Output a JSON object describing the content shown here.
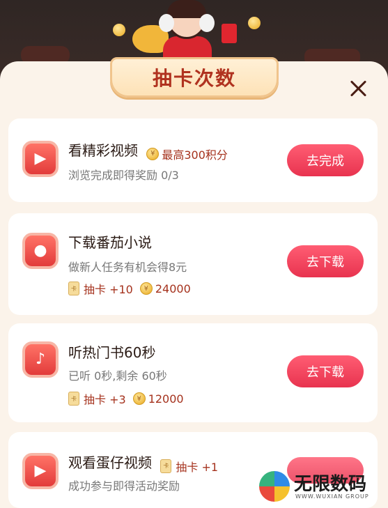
{
  "modal": {
    "title": "抽卡次数"
  },
  "tasks": [
    {
      "title": "看精彩视频",
      "title_reward": "最高300积分",
      "desc": "浏览完成即得奖励 0/3",
      "button": "去完成",
      "icon": "video-ad-icon"
    },
    {
      "title": "下载番茄小说",
      "desc": "做新人任务有机会得8元",
      "card_reward": "抽卡 +10",
      "coin_reward": "24000",
      "button": "去下载",
      "icon": "tomato-novel-icon"
    },
    {
      "title": "听热门书60秒",
      "desc": "已听 0秒,剩余 60秒",
      "card_reward": "抽卡 +3",
      "coin_reward": "12000",
      "button": "去下载",
      "icon": "audio-book-icon"
    },
    {
      "title": "观看蛋仔视频",
      "title_card_reward": "抽卡 +1",
      "desc": "成功参与即得活动奖励",
      "icon": "play-video-icon"
    }
  ],
  "watermark": {
    "name": "无限数码",
    "sub": "WWW.WUXIAN GROUP"
  },
  "colors": {
    "button": "#e8334f",
    "accent_text": "#a5321d",
    "sheet_bg": "#fbf3ea"
  }
}
